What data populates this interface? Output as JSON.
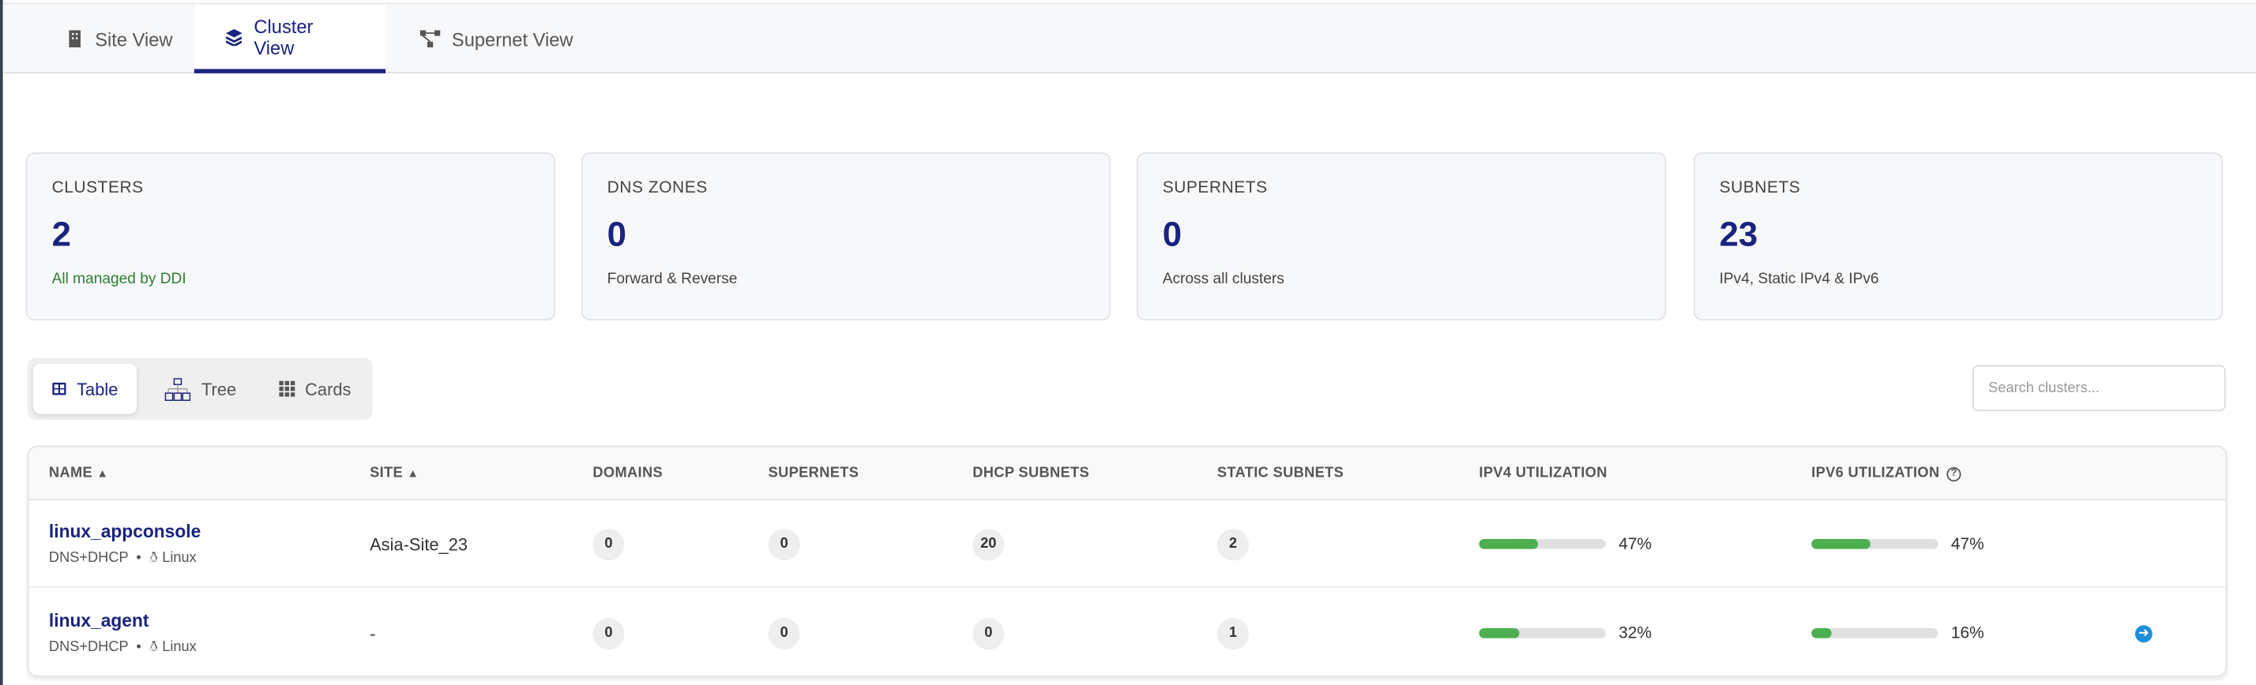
{
  "tabs": [
    {
      "label": "Site View",
      "icon": "building-icon"
    },
    {
      "label": "Cluster View",
      "icon": "layers-icon",
      "active": true
    },
    {
      "label": "Supernet View",
      "icon": "network-icon"
    }
  ],
  "stats": [
    {
      "label": "CLUSTERS",
      "value": "2",
      "sub": "All managed by DDI"
    },
    {
      "label": "DNS ZONES",
      "value": "0",
      "sub": "Forward & Reverse"
    },
    {
      "label": "SUPERNETS",
      "value": "0",
      "sub": "Across all clusters"
    },
    {
      "label": "SUBNETS",
      "value": "23",
      "sub": "IPv4, Static IPv4 & IPv6"
    }
  ],
  "view_toggle": {
    "table": "Table",
    "tree": "Tree",
    "cards": "Cards"
  },
  "search": {
    "placeholder": "Search clusters...",
    "value": ""
  },
  "table": {
    "headers": [
      "NAME",
      "SITE",
      "DOMAINS",
      "SUPERNETS",
      "DHCP SUBNETS",
      "STATIC SUBNETS",
      "IPV4 UTILIZATION",
      "IPV6 UTILIZATION"
    ],
    "rows": [
      {
        "name": "linux_appconsole",
        "type": "DNS+DHCP",
        "os": "Linux",
        "site": "Asia-Site_23",
        "domains": "0",
        "supernets": "0",
        "dhcp": "20",
        "static": "2",
        "ipv4": 47,
        "ipv4_label": "47%",
        "ipv6": 47,
        "ipv6_label": "47%"
      },
      {
        "name": "linux_agent",
        "type": "DNS+DHCP",
        "os": "Linux",
        "site": "-",
        "domains": "0",
        "supernets": "0",
        "dhcp": "0",
        "static": "1",
        "ipv4": 32,
        "ipv4_label": "32%",
        "ipv6": 16,
        "ipv6_label": "16%"
      }
    ]
  },
  "colors": {
    "accent": "#1a237e",
    "bar": "#4caf50",
    "action": "#1e8fdd"
  }
}
